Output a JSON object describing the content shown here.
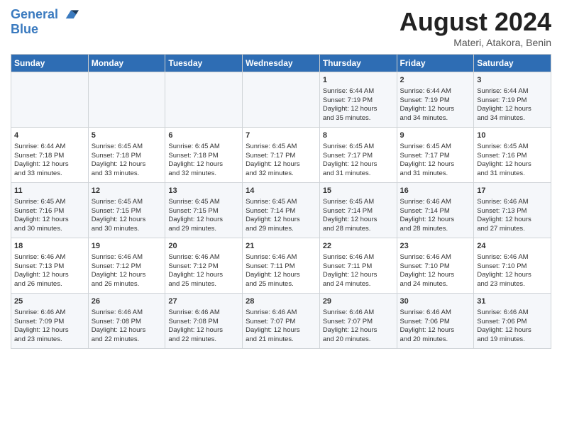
{
  "header": {
    "logo_line1": "General",
    "logo_line2": "Blue",
    "title": "August 2024",
    "subtitle": "Materi, Atakora, Benin"
  },
  "weekdays": [
    "Sunday",
    "Monday",
    "Tuesday",
    "Wednesday",
    "Thursday",
    "Friday",
    "Saturday"
  ],
  "weeks": [
    [
      {
        "day": "",
        "empty": true
      },
      {
        "day": "",
        "empty": true
      },
      {
        "day": "",
        "empty": true
      },
      {
        "day": "",
        "empty": true
      },
      {
        "day": "1",
        "line1": "Sunrise: 6:44 AM",
        "line2": "Sunset: 7:19 PM",
        "line3": "Daylight: 12 hours",
        "line4": "and 35 minutes."
      },
      {
        "day": "2",
        "line1": "Sunrise: 6:44 AM",
        "line2": "Sunset: 7:19 PM",
        "line3": "Daylight: 12 hours",
        "line4": "and 34 minutes."
      },
      {
        "day": "3",
        "line1": "Sunrise: 6:44 AM",
        "line2": "Sunset: 7:19 PM",
        "line3": "Daylight: 12 hours",
        "line4": "and 34 minutes."
      }
    ],
    [
      {
        "day": "4",
        "line1": "Sunrise: 6:44 AM",
        "line2": "Sunset: 7:18 PM",
        "line3": "Daylight: 12 hours",
        "line4": "and 33 minutes."
      },
      {
        "day": "5",
        "line1": "Sunrise: 6:45 AM",
        "line2": "Sunset: 7:18 PM",
        "line3": "Daylight: 12 hours",
        "line4": "and 33 minutes."
      },
      {
        "day": "6",
        "line1": "Sunrise: 6:45 AM",
        "line2": "Sunset: 7:18 PM",
        "line3": "Daylight: 12 hours",
        "line4": "and 32 minutes."
      },
      {
        "day": "7",
        "line1": "Sunrise: 6:45 AM",
        "line2": "Sunset: 7:17 PM",
        "line3": "Daylight: 12 hours",
        "line4": "and 32 minutes."
      },
      {
        "day": "8",
        "line1": "Sunrise: 6:45 AM",
        "line2": "Sunset: 7:17 PM",
        "line3": "Daylight: 12 hours",
        "line4": "and 31 minutes."
      },
      {
        "day": "9",
        "line1": "Sunrise: 6:45 AM",
        "line2": "Sunset: 7:17 PM",
        "line3": "Daylight: 12 hours",
        "line4": "and 31 minutes."
      },
      {
        "day": "10",
        "line1": "Sunrise: 6:45 AM",
        "line2": "Sunset: 7:16 PM",
        "line3": "Daylight: 12 hours",
        "line4": "and 31 minutes."
      }
    ],
    [
      {
        "day": "11",
        "line1": "Sunrise: 6:45 AM",
        "line2": "Sunset: 7:16 PM",
        "line3": "Daylight: 12 hours",
        "line4": "and 30 minutes."
      },
      {
        "day": "12",
        "line1": "Sunrise: 6:45 AM",
        "line2": "Sunset: 7:15 PM",
        "line3": "Daylight: 12 hours",
        "line4": "and 30 minutes."
      },
      {
        "day": "13",
        "line1": "Sunrise: 6:45 AM",
        "line2": "Sunset: 7:15 PM",
        "line3": "Daylight: 12 hours",
        "line4": "and 29 minutes."
      },
      {
        "day": "14",
        "line1": "Sunrise: 6:45 AM",
        "line2": "Sunset: 7:14 PM",
        "line3": "Daylight: 12 hours",
        "line4": "and 29 minutes."
      },
      {
        "day": "15",
        "line1": "Sunrise: 6:45 AM",
        "line2": "Sunset: 7:14 PM",
        "line3": "Daylight: 12 hours",
        "line4": "and 28 minutes."
      },
      {
        "day": "16",
        "line1": "Sunrise: 6:46 AM",
        "line2": "Sunset: 7:14 PM",
        "line3": "Daylight: 12 hours",
        "line4": "and 28 minutes."
      },
      {
        "day": "17",
        "line1": "Sunrise: 6:46 AM",
        "line2": "Sunset: 7:13 PM",
        "line3": "Daylight: 12 hours",
        "line4": "and 27 minutes."
      }
    ],
    [
      {
        "day": "18",
        "line1": "Sunrise: 6:46 AM",
        "line2": "Sunset: 7:13 PM",
        "line3": "Daylight: 12 hours",
        "line4": "and 26 minutes."
      },
      {
        "day": "19",
        "line1": "Sunrise: 6:46 AM",
        "line2": "Sunset: 7:12 PM",
        "line3": "Daylight: 12 hours",
        "line4": "and 26 minutes."
      },
      {
        "day": "20",
        "line1": "Sunrise: 6:46 AM",
        "line2": "Sunset: 7:12 PM",
        "line3": "Daylight: 12 hours",
        "line4": "and 25 minutes."
      },
      {
        "day": "21",
        "line1": "Sunrise: 6:46 AM",
        "line2": "Sunset: 7:11 PM",
        "line3": "Daylight: 12 hours",
        "line4": "and 25 minutes."
      },
      {
        "day": "22",
        "line1": "Sunrise: 6:46 AM",
        "line2": "Sunset: 7:11 PM",
        "line3": "Daylight: 12 hours",
        "line4": "and 24 minutes."
      },
      {
        "day": "23",
        "line1": "Sunrise: 6:46 AM",
        "line2": "Sunset: 7:10 PM",
        "line3": "Daylight: 12 hours",
        "line4": "and 24 minutes."
      },
      {
        "day": "24",
        "line1": "Sunrise: 6:46 AM",
        "line2": "Sunset: 7:10 PM",
        "line3": "Daylight: 12 hours",
        "line4": "and 23 minutes."
      }
    ],
    [
      {
        "day": "25",
        "line1": "Sunrise: 6:46 AM",
        "line2": "Sunset: 7:09 PM",
        "line3": "Daylight: 12 hours",
        "line4": "and 23 minutes."
      },
      {
        "day": "26",
        "line1": "Sunrise: 6:46 AM",
        "line2": "Sunset: 7:08 PM",
        "line3": "Daylight: 12 hours",
        "line4": "and 22 minutes."
      },
      {
        "day": "27",
        "line1": "Sunrise: 6:46 AM",
        "line2": "Sunset: 7:08 PM",
        "line3": "Daylight: 12 hours",
        "line4": "and 22 minutes."
      },
      {
        "day": "28",
        "line1": "Sunrise: 6:46 AM",
        "line2": "Sunset: 7:07 PM",
        "line3": "Daylight: 12 hours",
        "line4": "and 21 minutes."
      },
      {
        "day": "29",
        "line1": "Sunrise: 6:46 AM",
        "line2": "Sunset: 7:07 PM",
        "line3": "Daylight: 12 hours",
        "line4": "and 20 minutes."
      },
      {
        "day": "30",
        "line1": "Sunrise: 6:46 AM",
        "line2": "Sunset: 7:06 PM",
        "line3": "Daylight: 12 hours",
        "line4": "and 20 minutes."
      },
      {
        "day": "31",
        "line1": "Sunrise: 6:46 AM",
        "line2": "Sunset: 7:06 PM",
        "line3": "Daylight: 12 hours",
        "line4": "and 19 minutes."
      }
    ]
  ]
}
